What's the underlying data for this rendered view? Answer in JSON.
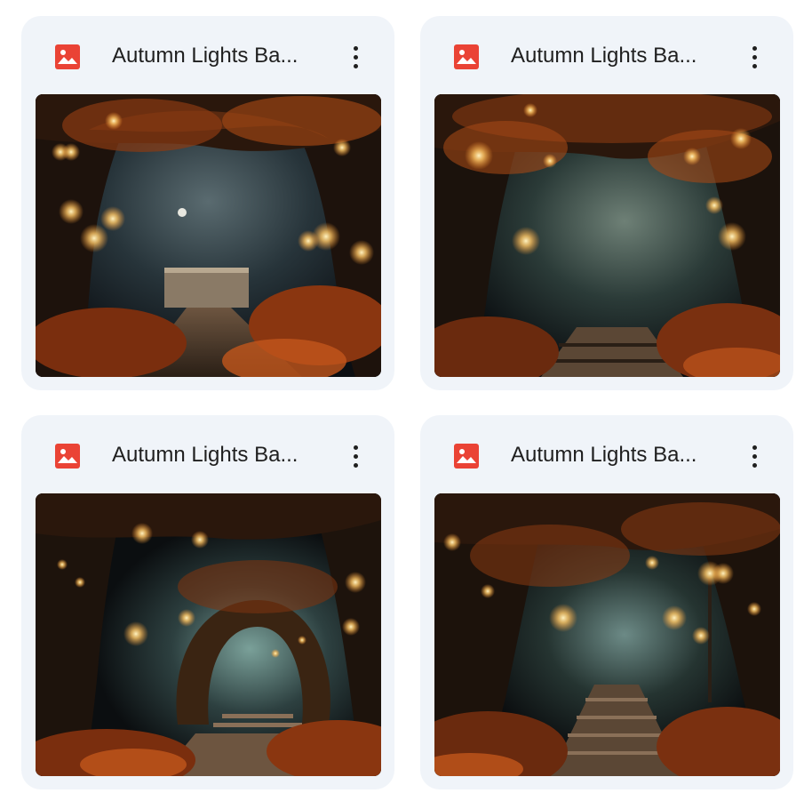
{
  "files": [
    {
      "title": "Autumn Lights Ba...",
      "file_type_icon": "image-file-icon",
      "menu_icon": "more-vertical-icon",
      "thumbnail": "autumn-forest-arch-lanterns-bridge"
    },
    {
      "title": "Autumn Lights Ba...",
      "file_type_icon": "image-file-icon",
      "menu_icon": "more-vertical-icon",
      "thumbnail": "autumn-forest-path-lanterns-stairs"
    },
    {
      "title": "Autumn Lights Ba...",
      "file_type_icon": "image-file-icon",
      "menu_icon": "more-vertical-icon",
      "thumbnail": "autumn-forest-arch-fireflies-steps"
    },
    {
      "title": "Autumn Lights Ba...",
      "file_type_icon": "image-file-icon",
      "menu_icon": "more-vertical-icon",
      "thumbnail": "autumn-forest-stairs-lamp-posts"
    }
  ],
  "colors": {
    "card_background": "#f0f4f9",
    "image_icon": "#ea4335",
    "title_text": "#1f1f1f",
    "lantern_glow": "#ffc766",
    "foliage": "#c2561c"
  }
}
